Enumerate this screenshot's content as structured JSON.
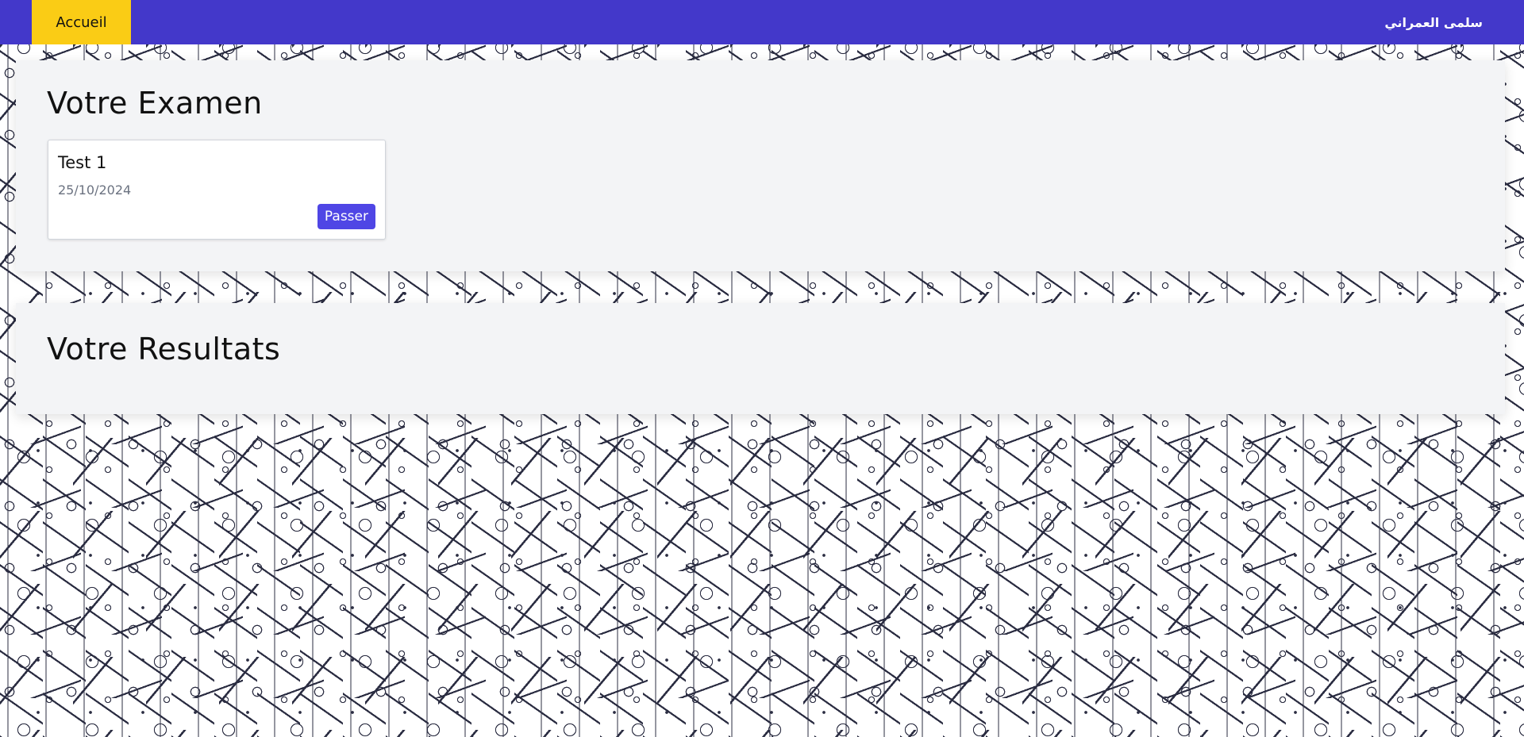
{
  "navbar": {
    "home_label": "Accueil",
    "user_name": "سلمى العمراني"
  },
  "exams_section": {
    "title": "Votre Examen",
    "cards": [
      {
        "title": "Test 1",
        "date": "25/10/2024",
        "button_label": "Passer"
      }
    ]
  },
  "results_section": {
    "title": "Votre Resultats"
  },
  "colors": {
    "navbar": "#4338ca",
    "home_tab": "#facc15",
    "button": "#4f46e5",
    "panel": "#f3f4f6"
  }
}
